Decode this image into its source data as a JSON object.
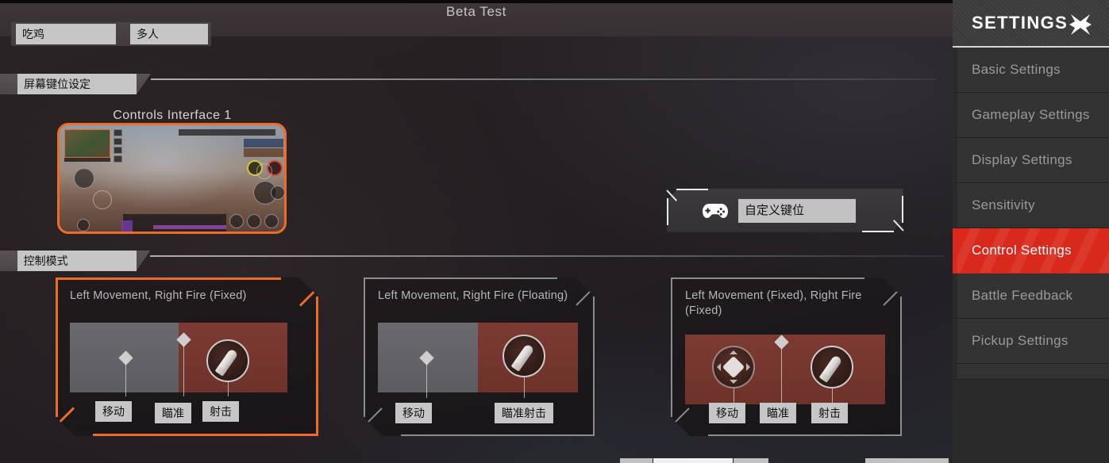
{
  "app": {
    "title": "Beta Test"
  },
  "tabs": [
    {
      "label": "吃鸡",
      "name": "tab-battle-royale"
    },
    {
      "label": "多人",
      "name": "tab-multiplayer"
    }
  ],
  "sections": {
    "screen_layout": "屏幕键位设定",
    "control_mode": "控制模式"
  },
  "interface_preview": {
    "title": "Controls Interface 1",
    "selected": true,
    "accent_color": "#ef6b28"
  },
  "keybind_button": {
    "icon": "gamepad-icon",
    "value": "自定义键位"
  },
  "control_modes": [
    {
      "title": "Left Movement, Right Fire (Fixed)",
      "selected": true,
      "captions": [
        "移动",
        "瞄准",
        "射击"
      ]
    },
    {
      "title": "Left Movement, Right Fire (Floating)",
      "selected": false,
      "captions": [
        "移动",
        "瞄准射击"
      ]
    },
    {
      "title": "Left Movement (Fixed), Right Fire (Fixed)",
      "selected": false,
      "captions": [
        "移动",
        "瞄准",
        "射击"
      ]
    }
  ],
  "sidebar": {
    "title": "SETTINGS",
    "close_icon": "close-x-icon",
    "active_color": "#d9291c",
    "items": [
      {
        "label": "Basic Settings",
        "active": false
      },
      {
        "label": "Gameplay Settings",
        "active": false
      },
      {
        "label": "Display Settings",
        "active": false
      },
      {
        "label": "Sensitivity",
        "active": false
      },
      {
        "label": "Control Settings",
        "active": true
      },
      {
        "label": "Battle Feedback",
        "active": false
      },
      {
        "label": "Pickup Settings",
        "active": false
      }
    ]
  }
}
